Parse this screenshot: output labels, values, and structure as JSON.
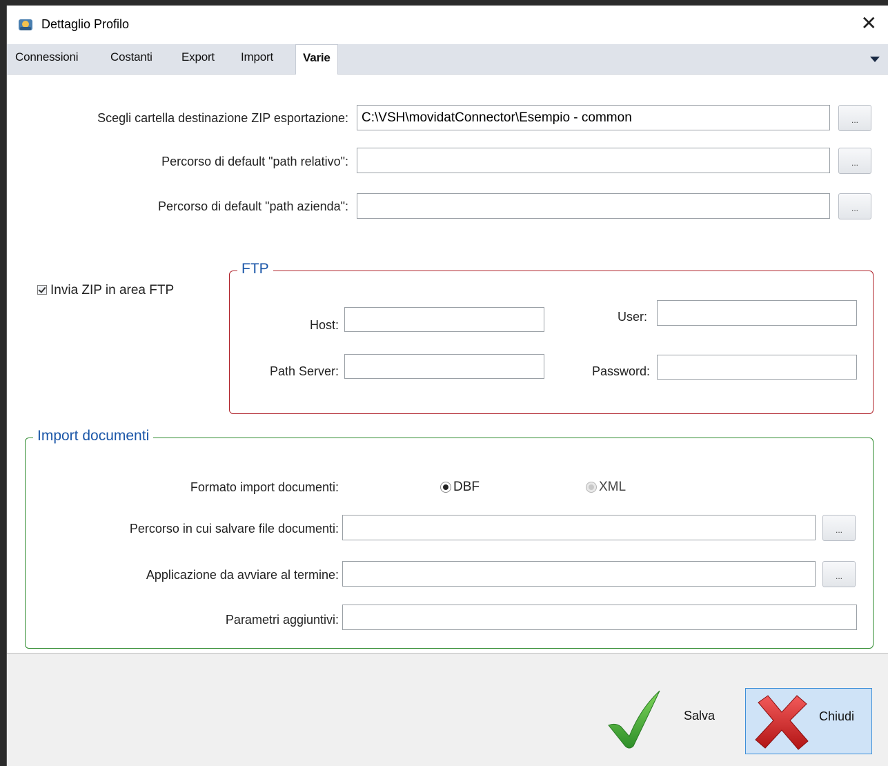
{
  "window": {
    "title": "Dettaglio Profilo"
  },
  "tabs": [
    "Connessioni",
    "Costanti",
    "Export",
    "Import",
    "Varie"
  ],
  "active_tab": "Varie",
  "paths": {
    "zip_label": "Scegli cartella destinazione ZIP esportazione:",
    "zip_value": "C:\\VSH\\movidatConnector\\Esempio - common",
    "relativo_label": "Percorso di default \"path relativo\":",
    "relativo_value": "",
    "azienda_label": "Percorso di default \"path azienda\":",
    "azienda_value": "",
    "browse_label": "..."
  },
  "ftp": {
    "checkbox_label": "Invia ZIP in area FTP",
    "checked": true,
    "legend": "FTP",
    "host_label": "Host:",
    "host_value": "",
    "user_label": "User:",
    "user_value": "",
    "path_label": "Path Server:",
    "path_value": "",
    "password_label": "Password:",
    "password_value": ""
  },
  "import_docs": {
    "legend": "Import documenti",
    "format_label": "Formato import documenti:",
    "option_dbf": "DBF",
    "option_xml": "XML",
    "selected_format": "DBF",
    "save_path_label": "Percorso in cui salvare file documenti:",
    "save_path_value": "",
    "app_label": "Applicazione da avviare al termine:",
    "app_value": "",
    "params_label": "Parametri aggiuntivi:",
    "params_value": ""
  },
  "footer": {
    "save_label": "Salva",
    "close_label": "Chiudi"
  },
  "colors": {
    "ftp_border": "#b0232b",
    "docs_border": "#2e8b2e",
    "legend_text": "#1a56a8",
    "close_btn_bg": "#cfe3f7"
  }
}
